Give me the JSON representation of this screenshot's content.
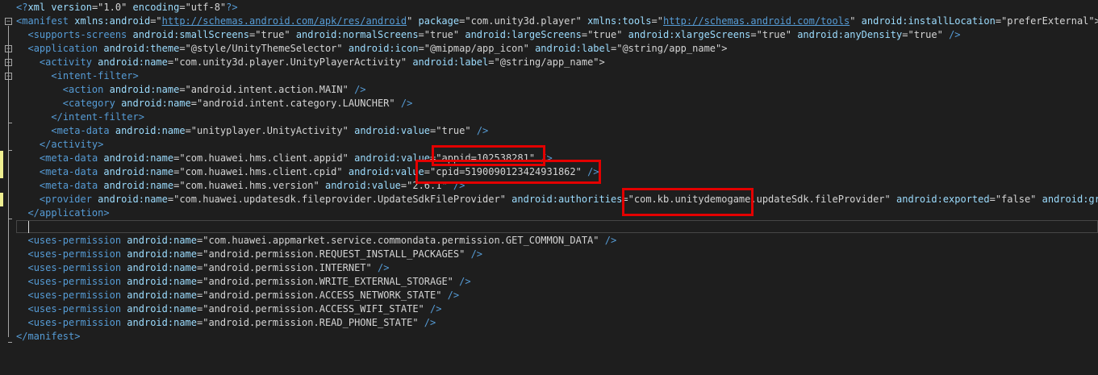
{
  "editor": {
    "lines": [
      {
        "indent": "",
        "parts": [
          [
            "t",
            "<?"
          ],
          [
            "a",
            "xml"
          ],
          [
            "q",
            " "
          ],
          [
            "a",
            "version"
          ],
          [
            "q",
            "=\""
          ],
          [
            "v",
            "1.0"
          ],
          [
            "q",
            "\" "
          ],
          [
            "a",
            "encoding"
          ],
          [
            "q",
            "=\""
          ],
          [
            "v",
            "utf-8"
          ],
          [
            "q",
            "\""
          ],
          [
            "t",
            "?>"
          ]
        ]
      },
      {
        "indent": "",
        "parts": [
          [
            "t",
            "<"
          ],
          [
            "t",
            "manifest"
          ],
          [
            "q",
            " "
          ],
          [
            "a",
            "xmlns:android"
          ],
          [
            "q",
            "=\""
          ],
          [
            "u",
            "http://schemas.android.com/apk/res/android"
          ],
          [
            "q",
            "\" "
          ],
          [
            "a",
            "package"
          ],
          [
            "q",
            "=\""
          ],
          [
            "v",
            "com.unity3d.player"
          ],
          [
            "q",
            "\" "
          ],
          [
            "a",
            "xmlns:tools"
          ],
          [
            "q",
            "=\""
          ],
          [
            "u",
            "http://schemas.android.com/tools"
          ],
          [
            "q",
            "\" "
          ],
          [
            "a",
            "android:installLocation"
          ],
          [
            "q",
            "=\""
          ],
          [
            "v",
            "preferExternal"
          ],
          [
            "q",
            "\">"
          ]
        ]
      },
      {
        "indent": "  ",
        "parts": [
          [
            "t",
            "<"
          ],
          [
            "t",
            "supports-screens"
          ],
          [
            "q",
            " "
          ],
          [
            "a",
            "android:smallScreens"
          ],
          [
            "q",
            "=\""
          ],
          [
            "v",
            "true"
          ],
          [
            "q",
            "\" "
          ],
          [
            "a",
            "android:normalScreens"
          ],
          [
            "q",
            "=\""
          ],
          [
            "v",
            "true"
          ],
          [
            "q",
            "\" "
          ],
          [
            "a",
            "android:largeScreens"
          ],
          [
            "q",
            "=\""
          ],
          [
            "v",
            "true"
          ],
          [
            "q",
            "\" "
          ],
          [
            "a",
            "android:xlargeScreens"
          ],
          [
            "q",
            "=\""
          ],
          [
            "v",
            "true"
          ],
          [
            "q",
            "\" "
          ],
          [
            "a",
            "android:anyDensity"
          ],
          [
            "q",
            "=\""
          ],
          [
            "v",
            "true"
          ],
          [
            "q",
            "\" "
          ],
          [
            "t",
            "/>"
          ]
        ]
      },
      {
        "indent": "  ",
        "parts": [
          [
            "t",
            "<"
          ],
          [
            "t",
            "application"
          ],
          [
            "q",
            " "
          ],
          [
            "a",
            "android:theme"
          ],
          [
            "q",
            "=\""
          ],
          [
            "v",
            "@style/UnityThemeSelector"
          ],
          [
            "q",
            "\" "
          ],
          [
            "a",
            "android:icon"
          ],
          [
            "q",
            "=\""
          ],
          [
            "v",
            "@mipmap/app_icon"
          ],
          [
            "q",
            "\" "
          ],
          [
            "a",
            "android:label"
          ],
          [
            "q",
            "=\""
          ],
          [
            "v",
            "@string/app_name"
          ],
          [
            "q",
            "\">"
          ]
        ]
      },
      {
        "indent": "    ",
        "parts": [
          [
            "t",
            "<"
          ],
          [
            "t",
            "activity"
          ],
          [
            "q",
            " "
          ],
          [
            "a",
            "android:name"
          ],
          [
            "q",
            "=\""
          ],
          [
            "v",
            "com.unity3d.player.UnityPlayerActivity"
          ],
          [
            "q",
            "\" "
          ],
          [
            "a",
            "android:label"
          ],
          [
            "q",
            "=\""
          ],
          [
            "v",
            "@string/app_name"
          ],
          [
            "q",
            "\">"
          ]
        ]
      },
      {
        "indent": "      ",
        "parts": [
          [
            "t",
            "<"
          ],
          [
            "t",
            "intent-filter"
          ],
          [
            "t",
            ">"
          ]
        ]
      },
      {
        "indent": "        ",
        "parts": [
          [
            "t",
            "<"
          ],
          [
            "t",
            "action"
          ],
          [
            "q",
            " "
          ],
          [
            "a",
            "android:name"
          ],
          [
            "q",
            "=\""
          ],
          [
            "v",
            "android.intent.action.MAIN"
          ],
          [
            "q",
            "\" "
          ],
          [
            "t",
            "/>"
          ]
        ]
      },
      {
        "indent": "        ",
        "parts": [
          [
            "t",
            "<"
          ],
          [
            "t",
            "category"
          ],
          [
            "q",
            " "
          ],
          [
            "a",
            "android:name"
          ],
          [
            "q",
            "=\""
          ],
          [
            "v",
            "android.intent.category.LAUNCHER"
          ],
          [
            "q",
            "\" "
          ],
          [
            "t",
            "/>"
          ]
        ]
      },
      {
        "indent": "      ",
        "parts": [
          [
            "t",
            "</"
          ],
          [
            "t",
            "intent-filter"
          ],
          [
            "t",
            ">"
          ]
        ]
      },
      {
        "indent": "      ",
        "parts": [
          [
            "t",
            "<"
          ],
          [
            "t",
            "meta-data"
          ],
          [
            "q",
            " "
          ],
          [
            "a",
            "android:name"
          ],
          [
            "q",
            "=\""
          ],
          [
            "v",
            "unityplayer.UnityActivity"
          ],
          [
            "q",
            "\" "
          ],
          [
            "a",
            "android:value"
          ],
          [
            "q",
            "=\""
          ],
          [
            "v",
            "true"
          ],
          [
            "q",
            "\" "
          ],
          [
            "t",
            "/>"
          ]
        ]
      },
      {
        "indent": "    ",
        "parts": [
          [
            "t",
            "</"
          ],
          [
            "t",
            "activity"
          ],
          [
            "t",
            ">"
          ]
        ]
      },
      {
        "indent": "    ",
        "parts": [
          [
            "t",
            "<"
          ],
          [
            "t",
            "meta-data"
          ],
          [
            "q",
            " "
          ],
          [
            "a",
            "android:name"
          ],
          [
            "q",
            "=\""
          ],
          [
            "v",
            "com.huawei.hms.client.appid"
          ],
          [
            "q",
            "\" "
          ],
          [
            "a",
            "android:value"
          ],
          [
            "q",
            "=\""
          ],
          [
            "v",
            "appid=102538281"
          ],
          [
            "q",
            "\" "
          ],
          [
            "t",
            "/>"
          ]
        ]
      },
      {
        "indent": "    ",
        "parts": [
          [
            "t",
            "<"
          ],
          [
            "t",
            "meta-data"
          ],
          [
            "q",
            " "
          ],
          [
            "a",
            "android:name"
          ],
          [
            "q",
            "=\""
          ],
          [
            "v",
            "com.huawei.hms.client.cpid"
          ],
          [
            "q",
            "\" "
          ],
          [
            "a",
            "android:value"
          ],
          [
            "q",
            "=\""
          ],
          [
            "v",
            "cpid=5190090123424931862"
          ],
          [
            "q",
            "\" "
          ],
          [
            "t",
            "/>"
          ]
        ]
      },
      {
        "indent": "    ",
        "parts": [
          [
            "t",
            "<"
          ],
          [
            "t",
            "meta-data"
          ],
          [
            "q",
            " "
          ],
          [
            "a",
            "android:name"
          ],
          [
            "q",
            "=\""
          ],
          [
            "v",
            "com.huawei.hms.version"
          ],
          [
            "q",
            "\" "
          ],
          [
            "a",
            "android:value"
          ],
          [
            "q",
            "=\""
          ],
          [
            "v",
            "2.6.1"
          ],
          [
            "q",
            "\" "
          ],
          [
            "t",
            "/>"
          ]
        ]
      },
      {
        "indent": "    ",
        "parts": [
          [
            "t",
            "<"
          ],
          [
            "t",
            "provider"
          ],
          [
            "q",
            " "
          ],
          [
            "a",
            "android:name"
          ],
          [
            "q",
            "=\""
          ],
          [
            "v",
            "com.huawei.updatesdk.fileprovider.UpdateSdkFileProvider"
          ],
          [
            "q",
            "\" "
          ],
          [
            "a",
            "android:authorities"
          ],
          [
            "q",
            "=\""
          ],
          [
            "v",
            "com.kb.unitydemogame.updateSdk.fileProvider"
          ],
          [
            "q",
            "\" "
          ],
          [
            "a",
            "android:exported"
          ],
          [
            "q",
            "=\""
          ],
          [
            "v",
            "false"
          ],
          [
            "q",
            "\" "
          ],
          [
            "a",
            "android:gra"
          ]
        ]
      },
      {
        "indent": "  ",
        "parts": [
          [
            "t",
            "</"
          ],
          [
            "t",
            "application"
          ],
          [
            "t",
            ">"
          ]
        ]
      },
      {
        "indent": "",
        "parts": []
      },
      {
        "indent": "  ",
        "parts": [
          [
            "t",
            "<"
          ],
          [
            "t",
            "uses-permission"
          ],
          [
            "q",
            " "
          ],
          [
            "a",
            "android:name"
          ],
          [
            "q",
            "=\""
          ],
          [
            "v",
            "com.huawei.appmarket.service.commondata.permission.GET_COMMON_DATA"
          ],
          [
            "q",
            "\" "
          ],
          [
            "t",
            "/>"
          ]
        ]
      },
      {
        "indent": "  ",
        "parts": [
          [
            "t",
            "<"
          ],
          [
            "t",
            "uses-permission"
          ],
          [
            "q",
            " "
          ],
          [
            "a",
            "android:name"
          ],
          [
            "q",
            "=\""
          ],
          [
            "v",
            "android.permission.REQUEST_INSTALL_PACKAGES"
          ],
          [
            "q",
            "\" "
          ],
          [
            "t",
            "/>"
          ]
        ]
      },
      {
        "indent": "  ",
        "parts": [
          [
            "t",
            "<"
          ],
          [
            "t",
            "uses-permission"
          ],
          [
            "q",
            " "
          ],
          [
            "a",
            "android:name"
          ],
          [
            "q",
            "=\""
          ],
          [
            "v",
            "android.permission.INTERNET"
          ],
          [
            "q",
            "\" "
          ],
          [
            "t",
            "/>"
          ]
        ]
      },
      {
        "indent": "  ",
        "parts": [
          [
            "t",
            "<"
          ],
          [
            "t",
            "uses-permission"
          ],
          [
            "q",
            " "
          ],
          [
            "a",
            "android:name"
          ],
          [
            "q",
            "=\""
          ],
          [
            "v",
            "android.permission.WRITE_EXTERNAL_STORAGE"
          ],
          [
            "q",
            "\" "
          ],
          [
            "t",
            "/>"
          ]
        ]
      },
      {
        "indent": "  ",
        "parts": [
          [
            "t",
            "<"
          ],
          [
            "t",
            "uses-permission"
          ],
          [
            "q",
            " "
          ],
          [
            "a",
            "android:name"
          ],
          [
            "q",
            "=\""
          ],
          [
            "v",
            "android.permission.ACCESS_NETWORK_STATE"
          ],
          [
            "q",
            "\" "
          ],
          [
            "t",
            "/>"
          ]
        ]
      },
      {
        "indent": "  ",
        "parts": [
          [
            "t",
            "<"
          ],
          [
            "t",
            "uses-permission"
          ],
          [
            "q",
            " "
          ],
          [
            "a",
            "android:name"
          ],
          [
            "q",
            "=\""
          ],
          [
            "v",
            "android.permission.ACCESS_WIFI_STATE"
          ],
          [
            "q",
            "\" "
          ],
          [
            "t",
            "/>"
          ]
        ]
      },
      {
        "indent": "  ",
        "parts": [
          [
            "t",
            "<"
          ],
          [
            "t",
            "uses-permission"
          ],
          [
            "q",
            " "
          ],
          [
            "a",
            "android:name"
          ],
          [
            "q",
            "=\""
          ],
          [
            "v",
            "android.permission.READ_PHONE_STATE"
          ],
          [
            "q",
            "\" "
          ],
          [
            "t",
            "/>"
          ]
        ]
      },
      {
        "indent": "",
        "parts": [
          [
            "t",
            "</"
          ],
          [
            "t",
            "manifest"
          ],
          [
            "t",
            ">"
          ]
        ]
      }
    ]
  },
  "colors": {
    "background": "#1e1e1e",
    "tag": "#569cd6",
    "attribute": "#9cdcfe",
    "value": "#d4d4d4",
    "changed_marker": "#efef91",
    "highlight_box": "#e30000"
  },
  "icons": {
    "fold": "fold-toggle-icon"
  }
}
